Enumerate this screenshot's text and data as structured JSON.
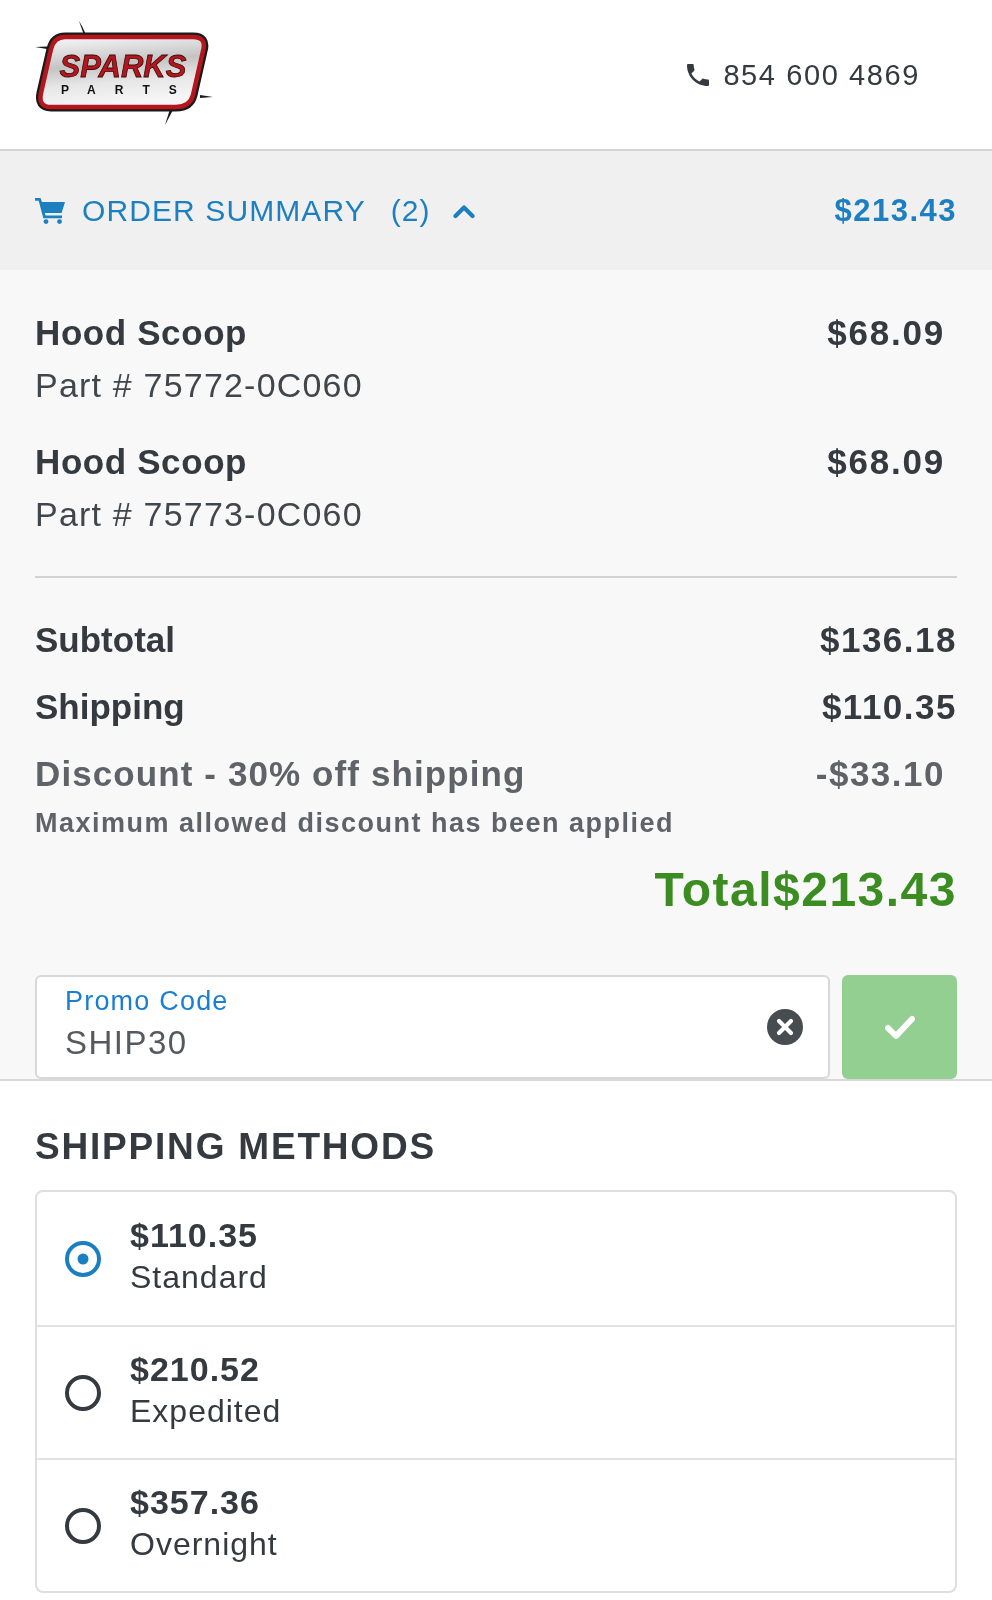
{
  "header": {
    "logo": {
      "name": "SPARKS",
      "tagline": "PARTS"
    },
    "phone": "854 600 4869"
  },
  "order_summary": {
    "title": "ORDER SUMMARY",
    "count": "(2)",
    "expanded": true,
    "total": "$213.43",
    "items": [
      {
        "name": "Hood Scoop",
        "part_number": "Part # 75772-0C060",
        "price": "$68.09"
      },
      {
        "name": "Hood Scoop",
        "part_number": "Part # 75773-0C060",
        "price": "$68.09"
      }
    ],
    "totals": [
      {
        "kind": "line",
        "label": "Subtotal",
        "value": "$136.18"
      },
      {
        "kind": "line",
        "label": "Shipping",
        "value": "$110.35"
      },
      {
        "kind": "discount",
        "label": "Discount - 30% off shipping",
        "value": "-$33.10",
        "note": "Maximum allowed discount has been applied"
      },
      {
        "kind": "total",
        "label": "Total",
        "value": "$213.43"
      }
    ],
    "promo": {
      "label": "Promo Code",
      "value": "SHIP30"
    }
  },
  "shipping_methods": {
    "title": "SHIPPING METHODS",
    "options": [
      {
        "price": "$110.35",
        "name": "Standard",
        "selected": true
      },
      {
        "price": "$210.52",
        "name": "Expedited",
        "selected": false
      },
      {
        "price": "$357.36",
        "name": "Overnight",
        "selected": false
      }
    ]
  }
}
